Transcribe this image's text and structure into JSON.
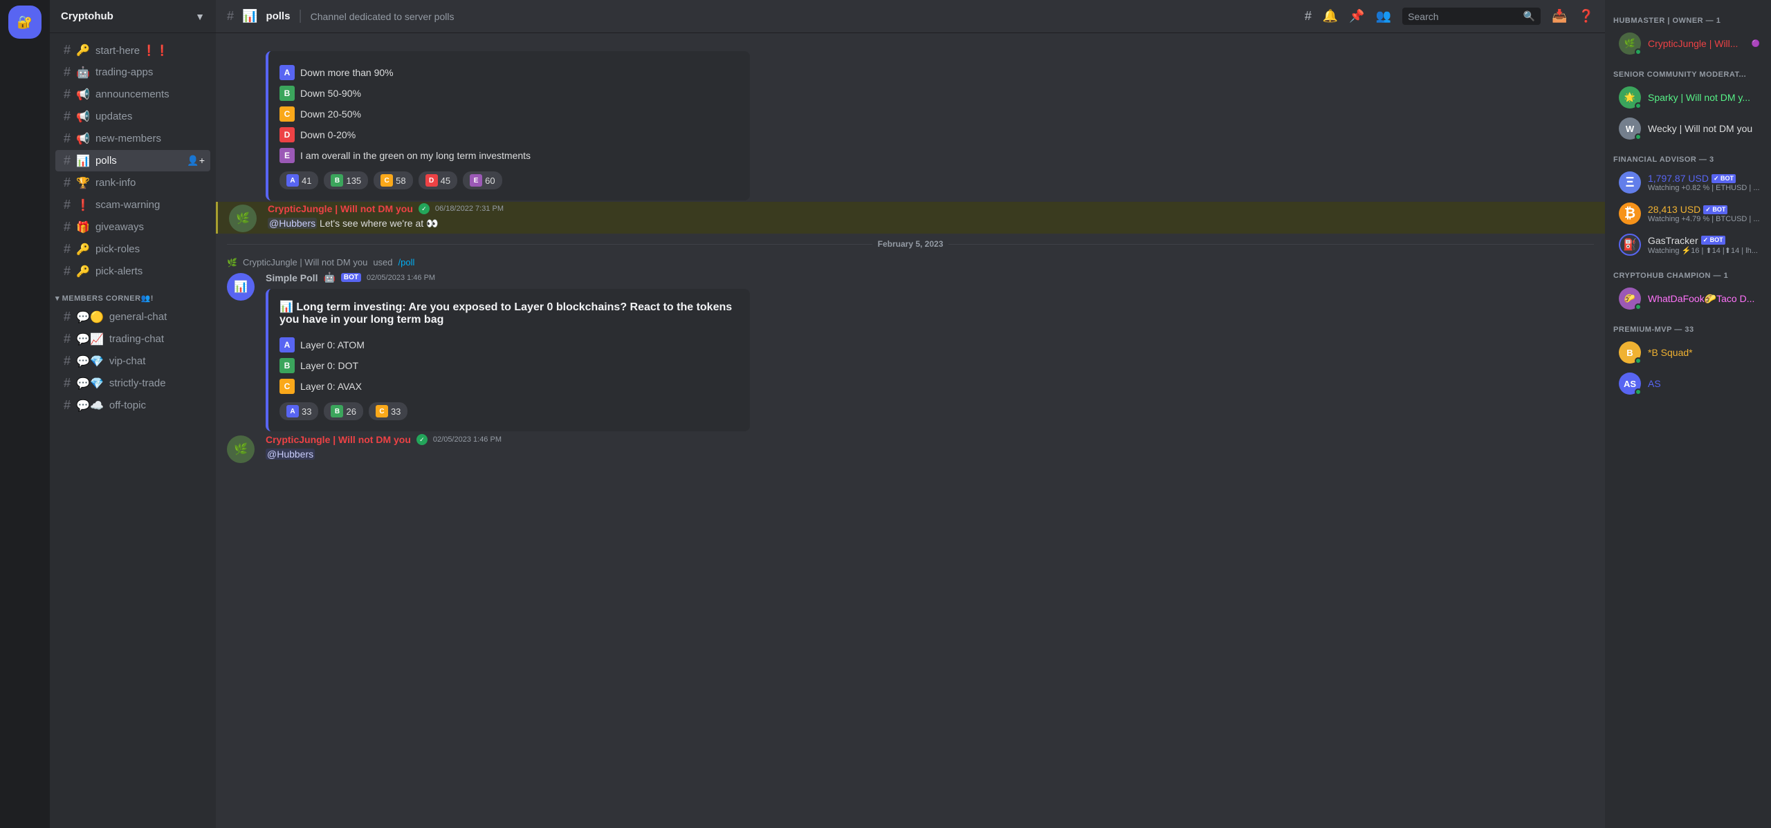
{
  "server": {
    "name": "Cryptohub",
    "icon": "🔐"
  },
  "channel": {
    "name": "polls",
    "description": "Channel dedicated to server polls",
    "icon": "📊"
  },
  "sidebar": {
    "channels": [
      {
        "id": "start-here",
        "name": "start-here",
        "emoji": "🔑",
        "suffix": "❗❗",
        "category": null
      },
      {
        "id": "trading-apps",
        "name": "trading-apps",
        "emoji": "🤖",
        "category": null
      },
      {
        "id": "announcements",
        "name": "announcements",
        "emoji": "📢",
        "category": null
      },
      {
        "id": "updates",
        "name": "updates",
        "emoji": "📢",
        "category": null
      },
      {
        "id": "new-members",
        "name": "new-members",
        "emoji": "📢",
        "category": null
      },
      {
        "id": "polls",
        "name": "polls",
        "emoji": "📊",
        "active": true,
        "category": null
      },
      {
        "id": "rank-info",
        "name": "rank-info",
        "emoji": "🏆",
        "category": null
      },
      {
        "id": "scam-warning",
        "name": "scam-warning",
        "emoji": "❗",
        "category": null
      },
      {
        "id": "giveaways",
        "name": "giveaways",
        "emoji": "🎁",
        "category": null
      },
      {
        "id": "pick-roles",
        "name": "pick-roles",
        "emoji": "🔑",
        "category": null
      },
      {
        "id": "pick-alerts",
        "name": "pick-alerts",
        "emoji": "🔑",
        "category": null
      }
    ],
    "categories": [
      {
        "id": "members-corner",
        "name": "MEMBERS CORNER👥!"
      }
    ],
    "memberChannels": [
      {
        "id": "general-chat",
        "name": "general-chat",
        "emoji": "💬🟡"
      },
      {
        "id": "trading-chat",
        "name": "trading-chat",
        "emoji": "💬📈"
      },
      {
        "id": "vip-chat",
        "name": "vip-chat",
        "emoji": "💬💎"
      },
      {
        "id": "strictly-trade",
        "name": "strictly-trade",
        "emoji": "💬💎"
      },
      {
        "id": "off-topic",
        "name": "off-topic",
        "emoji": "💬☁️"
      }
    ]
  },
  "messages": {
    "poll1": {
      "options": [
        {
          "letter": "A",
          "text": "Down more than 90%",
          "letterClass": "a"
        },
        {
          "letter": "B",
          "text": "Down 50-90%",
          "letterClass": "b"
        },
        {
          "letter": "C",
          "text": "Down 20-50%",
          "letterClass": "c"
        },
        {
          "letter": "D",
          "text": "Down 0-20%",
          "letterClass": "d"
        },
        {
          "letter": "E",
          "text": "I am overall in the green on my long term investments",
          "letterClass": "e"
        }
      ],
      "votes": [
        {
          "letter": "A",
          "count": "41"
        },
        {
          "letter": "B",
          "count": "135"
        },
        {
          "letter": "C",
          "count": "58"
        },
        {
          "letter": "D",
          "count": "45"
        },
        {
          "letter": "E",
          "count": "60"
        }
      ]
    },
    "msg1": {
      "author": "CrypticJungle | Will not DM you",
      "badge": "✓",
      "timestamp": "06/18/2022 7:31 PM",
      "text": "@Hubbers Let's see where we're at 👀"
    },
    "dateDivider": "February 5, 2023",
    "systemMsg": {
      "author": "CrypticJungle | Will not DM you",
      "text": " used ",
      "command": "/poll"
    },
    "poll2": {
      "botName": "Simple Poll",
      "timestamp": "02/05/2023 1:46 PM",
      "title": "📊 Long term investing: Are you exposed to Layer 0 blockchains? React to the tokens you have in your long term bag",
      "options": [
        {
          "letter": "A",
          "text": "Layer 0: ATOM",
          "letterClass": "a"
        },
        {
          "letter": "B",
          "text": "Layer 0: DOT",
          "letterClass": "b"
        },
        {
          "letter": "C",
          "text": "Layer 0: AVAX",
          "letterClass": "c"
        }
      ],
      "votes": [
        {
          "letter": "A",
          "count": "33"
        },
        {
          "letter": "B",
          "count": "26"
        },
        {
          "letter": "C",
          "count": "33"
        }
      ]
    },
    "msg2": {
      "author": "CrypticJungle | Will not DM you",
      "badge": "✓",
      "timestamp": "02/05/2023 1:46 PM",
      "text": "@Hubbers"
    }
  },
  "members": {
    "categories": [
      {
        "name": "HUBMASTER | OWNER — 1",
        "members": [
          {
            "id": "cj",
            "name": "CrypticJungle | Will...",
            "nameClass": "red",
            "status": "online",
            "hasDot": true
          }
        ]
      },
      {
        "name": "SENIOR COMMUNITY MODERAT...",
        "members": [
          {
            "id": "sparky",
            "name": "Sparky | Will not DM y...",
            "nameClass": "green",
            "status": "online",
            "hasDot": true
          },
          {
            "id": "wecky",
            "name": "Wecky | Will not DM you",
            "nameClass": "default",
            "status": "online",
            "hasDot": true
          }
        ]
      },
      {
        "name": "FINANCIAL ADVISOR — 3",
        "members": [
          {
            "id": "eth-bot",
            "name": "1,797.87 USD",
            "badge": "BOT",
            "sub": "Watching +0.82 % | ETHUSD | ...",
            "nameClass": "blue",
            "isBot": true
          },
          {
            "id": "btc-bot",
            "name": "28,413 USD",
            "badge": "BOT",
            "sub": "Watching +4.79 % | BTCUSD | ...",
            "nameClass": "gold",
            "isBot": true
          },
          {
            "id": "gas-tracker",
            "name": "GasTracker",
            "badge": "BOT",
            "sub": "Watching ⚡16 | ⬆14 |⬆14 | lh...",
            "nameClass": "default",
            "isBot": true
          }
        ]
      },
      {
        "name": "CRYPTOHUB CHAMPION — 1",
        "members": [
          {
            "id": "whatdafook",
            "name": "WhatDaFook🌮Taco D...",
            "nameClass": "pink",
            "status": "online",
            "hasDot": true
          }
        ]
      },
      {
        "name": "PREMIUM-MVP — 33",
        "members": [
          {
            "id": "bsquad",
            "name": "*B Squad*",
            "nameClass": "gold",
            "status": "online",
            "hasDot": true
          },
          {
            "id": "as",
            "name": "AS",
            "nameClass": "blue",
            "status": "online",
            "hasDot": true
          }
        ]
      }
    ]
  },
  "topbar": {
    "search_placeholder": "Search"
  }
}
